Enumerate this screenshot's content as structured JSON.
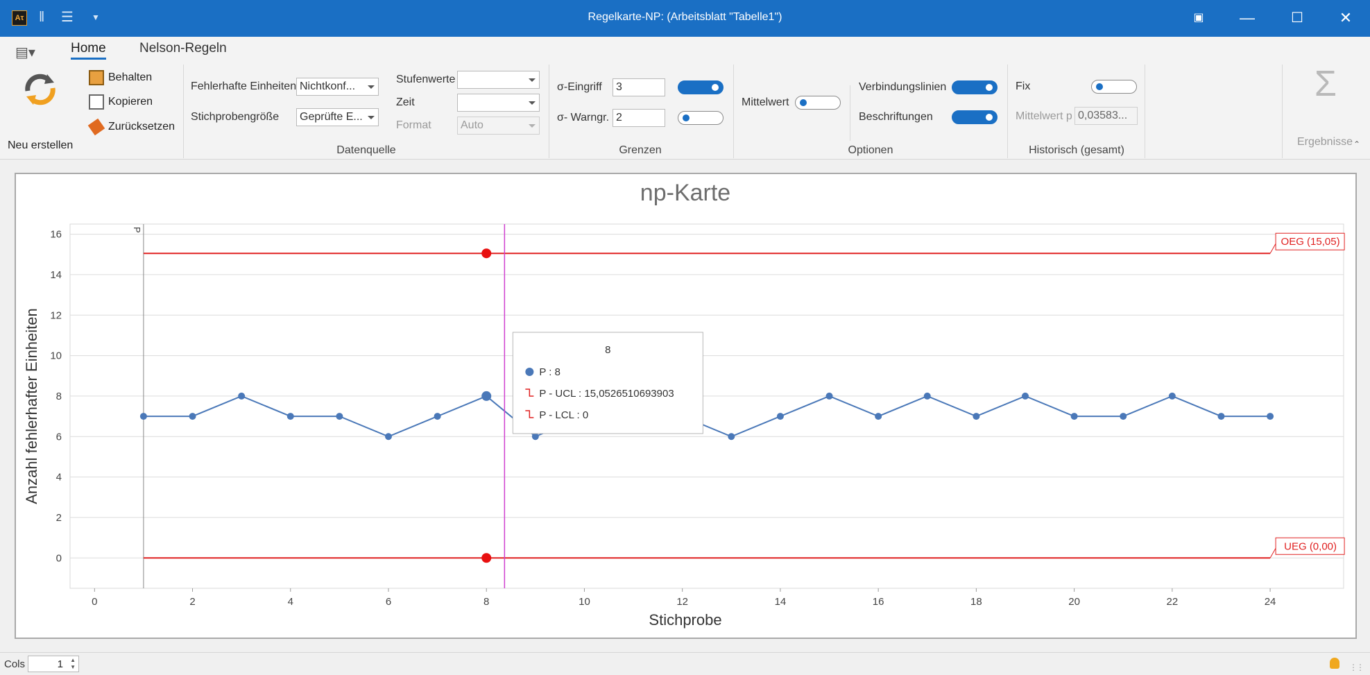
{
  "window": {
    "title": "Regelkarte-NP:  (Arbeitsblatt \"Tabelle1\")",
    "app_icon_text": "Aτ",
    "buttons": [
      "restore-icon",
      "minimize-icon",
      "maximize-icon",
      "close-icon"
    ]
  },
  "tabs": [
    {
      "label": "Home",
      "active": true
    },
    {
      "label": "Nelson-Regeln",
      "active": false
    }
  ],
  "ribbon": {
    "neu_erstellen": "Neu erstellen",
    "behalten": "Behalten",
    "kopieren": "Kopieren",
    "zuruecksetzen": "Zurücksetzen",
    "datenquelle": {
      "title": "Datenquelle",
      "fehlerhafte_label": "Fehlerhafte Einheiten",
      "fehlerhafte_value": "Nichtkonf...",
      "stichprobe_label": "Stichprobengröße",
      "stichprobe_value": "Geprüfte E...",
      "stufenwerte_label": "Stufenwerte",
      "stufenwerte_value": "",
      "zeit_label": "Zeit",
      "zeit_value": "",
      "format_label": "Format",
      "format_value": "Auto"
    },
    "grenzen": {
      "title": "Grenzen",
      "eingriff_label": "σ-Eingriff",
      "eingriff_value": "3",
      "eingriff_toggle": true,
      "warngr_label": "σ- Warngr.",
      "warngr_value": "2",
      "warngr_toggle": false
    },
    "optionen": {
      "title": "Optionen",
      "mittelwert_label": "Mittelwert",
      "mittelwert_toggle": false,
      "verbindungslinien_label": "Verbindungslinien",
      "verbindungslinien_toggle": true,
      "beschriftungen_label": "Beschriftungen",
      "beschriftungen_toggle": true
    },
    "historisch": {
      "title": "Historisch (gesamt)",
      "fix_label": "Fix",
      "fix_toggle": false,
      "mittelwert_p_label": "Mittelwert p",
      "mittelwert_p_value": "0,03583..."
    },
    "ergebnisse": "Ergebnisse"
  },
  "tooltip": {
    "header": "8",
    "p_line": "P : 8",
    "ucl_line": "P - UCL : 15,0526510693903",
    "lcl_line": "P - LCL : 0"
  },
  "chart_data": {
    "type": "line",
    "title": "np-Karte",
    "xlabel": "Stichprobe",
    "ylabel": "Anzahl fehlerhafter Einheiten",
    "xlim": [
      -0.5,
      25.5
    ],
    "ylim": [
      -1.5,
      16.5
    ],
    "xticks": [
      0,
      2,
      4,
      6,
      8,
      10,
      12,
      14,
      16,
      18,
      20,
      22,
      24
    ],
    "yticks": [
      0,
      2,
      4,
      6,
      8,
      10,
      12,
      14,
      16
    ],
    "grid": true,
    "series": [
      {
        "name": "P",
        "x": [
          1,
          2,
          3,
          4,
          5,
          6,
          7,
          8,
          9,
          10,
          11,
          12,
          13,
          14,
          15,
          16,
          17,
          18,
          19,
          20,
          21,
          22,
          23,
          24
        ],
        "values": [
          7,
          7,
          8,
          7,
          7,
          6,
          7,
          8,
          6,
          7,
          7,
          7,
          6,
          7,
          8,
          7,
          8,
          7,
          8,
          7,
          7,
          8,
          7,
          7
        ],
        "color": "#4a78b8"
      }
    ],
    "limits": [
      {
        "name": "OEG (15,05)",
        "value": 15.0526510693903,
        "color": "#e02020"
      },
      {
        "name": "UEG (0,00)",
        "value": 0,
        "color": "#e02020"
      }
    ],
    "phase_label": "P",
    "highlight_x": 8,
    "crosshair_x": 8.37
  },
  "status": {
    "cols_label": "Cols",
    "cols_value": "1"
  }
}
